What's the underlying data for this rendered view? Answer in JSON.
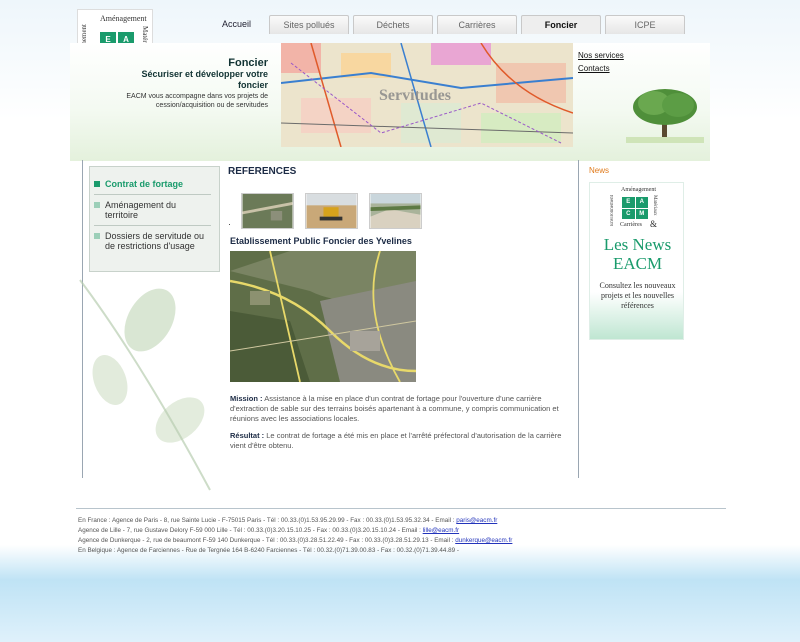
{
  "logo": {
    "top": "Aménagement",
    "left": "Environnement",
    "right": "Matériaux",
    "letters": [
      "E",
      "A",
      "C",
      "M"
    ],
    "bottom": "Carrières",
    "amp": "&"
  },
  "nav": {
    "home": "Accueil",
    "tabs": [
      "Sites pollués",
      "Déchets",
      "Carrières",
      "Foncier",
      "ICPE"
    ],
    "active": "Foncier"
  },
  "banner": {
    "title": "Foncier",
    "subtitle": "Sécuriser et développer votre foncier",
    "description": "EACM vous accompagne dans vos projets de cession/acquisition ou de servitudes",
    "image_text": "Servitudes"
  },
  "links": [
    "Nos services",
    "Contacts"
  ],
  "sidebar": {
    "items": [
      {
        "label": "Contrat de fortage",
        "active": true
      },
      {
        "label": "Aménagement du territoire",
        "active": false
      },
      {
        "label": "Dossiers de servitude ou de restrictions d'usage",
        "active": false
      }
    ]
  },
  "main": {
    "heading": "REFERENCES",
    "bullet": "·",
    "reference_title": "Etablissement Public Foncier des Yvelines",
    "mission_label": "Mission :",
    "mission_text": "Assistance à la mise en place d'un contrat de fortage pour l'ouverture d'une carrière d'extraction de sable sur des terrains boisés apartenant à a commune, y compris communication et réunions avec les associations locales.",
    "result_label": "Résultat :",
    "result_text": "Le contrat de fortage a été mis en place et l'arrêté préfectoral d'autorisation de la carrière vient d'être obtenu."
  },
  "news": {
    "title": "News",
    "big": "Les News EACM",
    "small": "Consultez les nouveaux projets et les nouvelles références"
  },
  "footer": {
    "lines": [
      {
        "text": "En France : Agence de Paris - 8, rue Sainte Lucie - F-75015 Paris - Tél : 00.33.(0)1.53.95.29.99 - Fax : 00.33.(0)1.53.95.32.34 - Email : ",
        "email": "paris@eacm.fr"
      },
      {
        "text": "Agence de Lille - 7, rue Gustave Delory F-59 000 Lille - Tél : 00.33.(0)3.20.15.10.25 - Fax : 00.33.(0)3.20.15.10.24 - Email : ",
        "email": "lille@eacm.fr"
      },
      {
        "text": "Agence de Dunkerque - 2, rue de beaumont F-59 140 Dunkerque - Tél : 00.33.(0)3.28.51.22.49 - Fax : 00.33.(0)3.28.51.29.13 - Email : ",
        "email": "dunkerque@eacm.fr"
      },
      {
        "text": "En Belgique : Agence de Farciennes - Rue de Tergnée 164 B-6240 Farciennes - Tél : 00.32.(0)71.39.00.83 - Fax : 00.32.(0)71.39.44.89 -",
        "email": ""
      }
    ]
  }
}
